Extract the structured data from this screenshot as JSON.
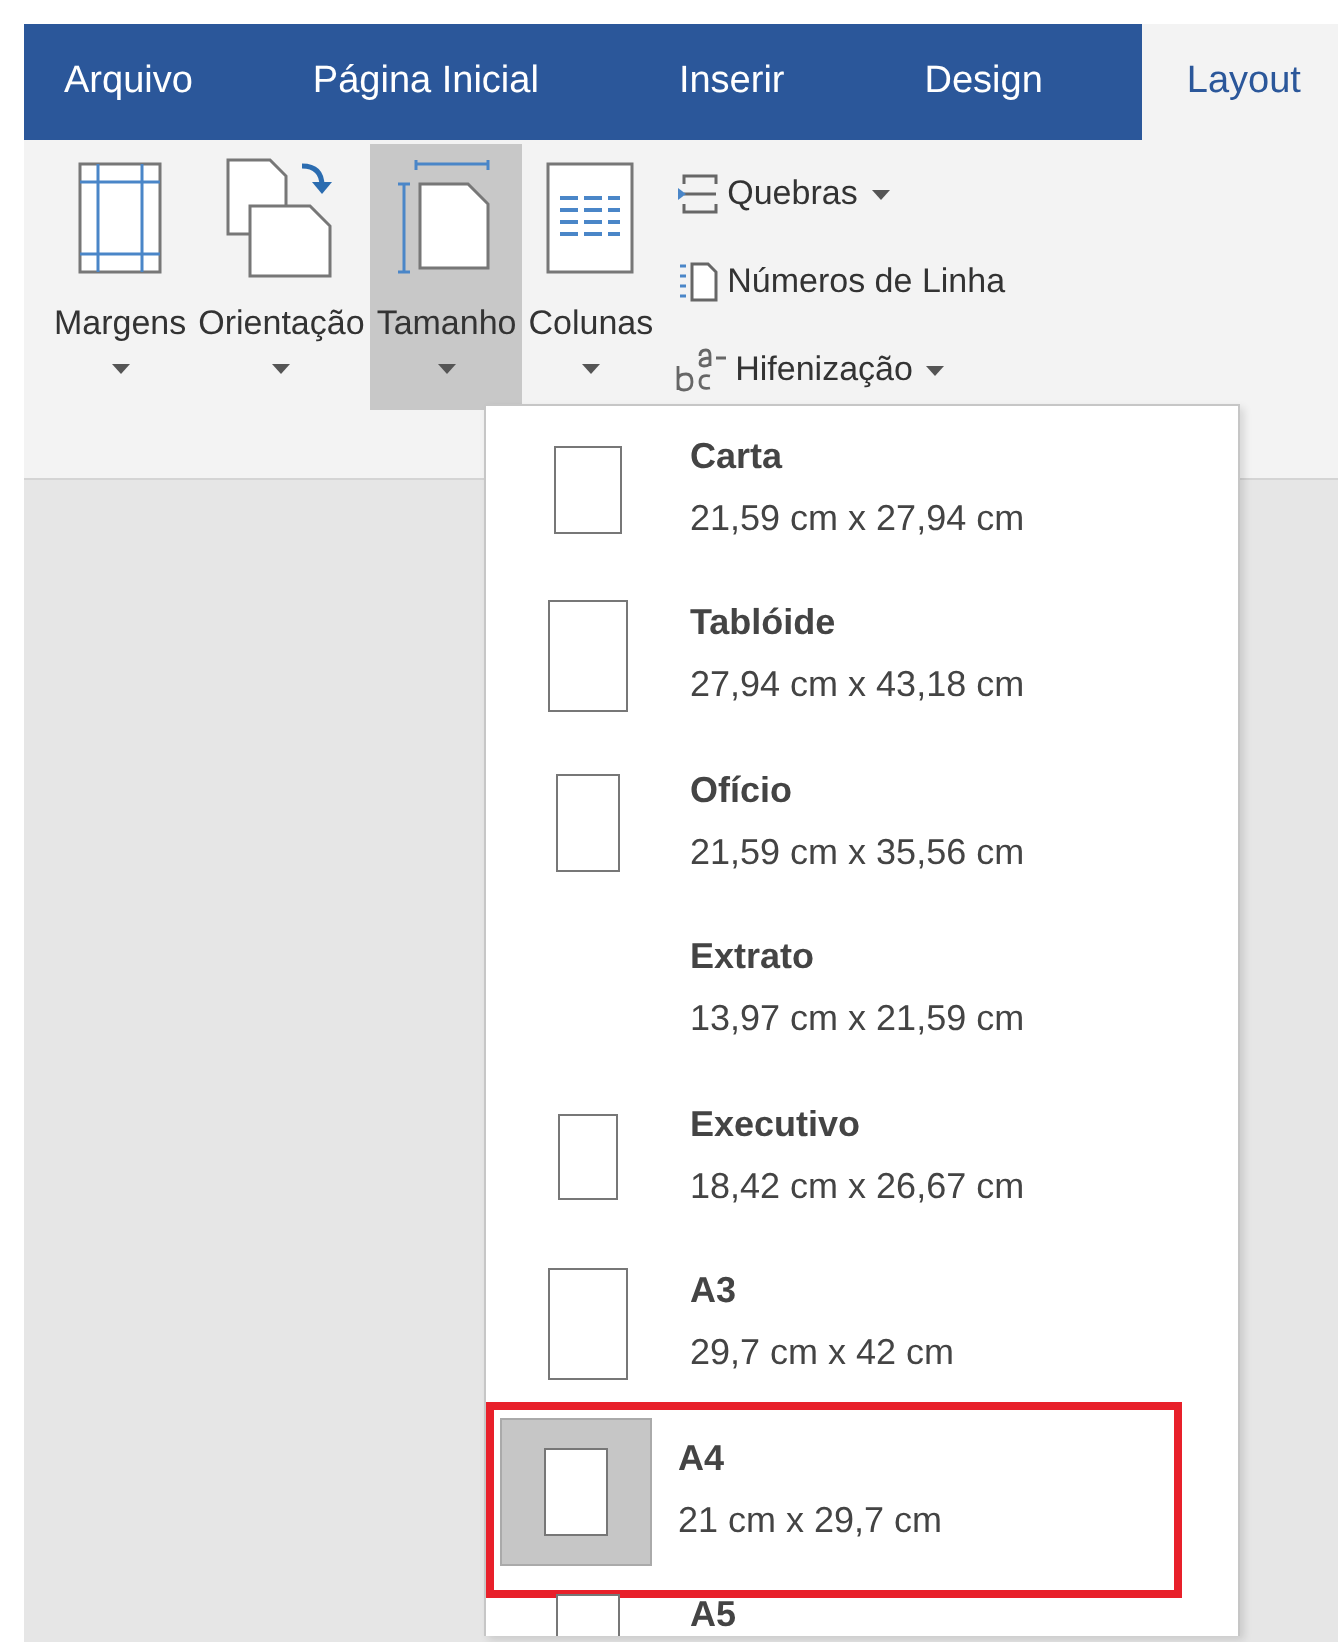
{
  "tabs": [
    {
      "label": "Arquivo",
      "selected": false
    },
    {
      "label": "Página Inicial",
      "selected": false
    },
    {
      "label": "Inserir",
      "selected": false
    },
    {
      "label": "Design",
      "selected": false
    },
    {
      "label": "Layout",
      "selected": true
    }
  ],
  "ribbon": {
    "large_buttons": [
      {
        "label": "Margens",
        "kind": "margins",
        "selected": false
      },
      {
        "label": "Orientação",
        "kind": "orientation",
        "selected": false
      },
      {
        "label": "Tamanho",
        "kind": "size",
        "selected": true
      },
      {
        "label": "Colunas",
        "kind": "columns",
        "selected": false
      }
    ],
    "small_buttons": [
      {
        "label": "Quebras",
        "kind": "breaks",
        "dropdown": true
      },
      {
        "label": "Números de Linha",
        "kind": "line-numbers",
        "dropdown": false
      },
      {
        "label": "Hifenização",
        "kind": "hyphenation",
        "dropdown": true
      }
    ]
  },
  "size_menu": {
    "items": [
      {
        "name": "Carta",
        "dimensions": "21,59 cm x 27,94 cm",
        "icon": true,
        "selected": false,
        "highlighted": false
      },
      {
        "name": "Tablóide",
        "dimensions": "27,94 cm x 43,18 cm",
        "icon": true,
        "selected": false,
        "highlighted": false
      },
      {
        "name": "Ofício",
        "dimensions": "21,59 cm x 35,56 cm",
        "icon": true,
        "selected": false,
        "highlighted": false
      },
      {
        "name": "Extrato",
        "dimensions": "13,97 cm x 21,59 cm",
        "icon": false,
        "selected": false,
        "highlighted": false
      },
      {
        "name": "Executivo",
        "dimensions": "18,42 cm x 26,67 cm",
        "icon": true,
        "selected": false,
        "highlighted": false
      },
      {
        "name": "A3",
        "dimensions": "29,7 cm x 42 cm",
        "icon": true,
        "selected": false,
        "highlighted": false
      },
      {
        "name": "A4",
        "dimensions": "21 cm x 29,7 cm",
        "icon": true,
        "selected": true,
        "highlighted": true
      },
      {
        "name": "A5",
        "icon": true,
        "selected": false,
        "highlighted": false
      }
    ]
  }
}
